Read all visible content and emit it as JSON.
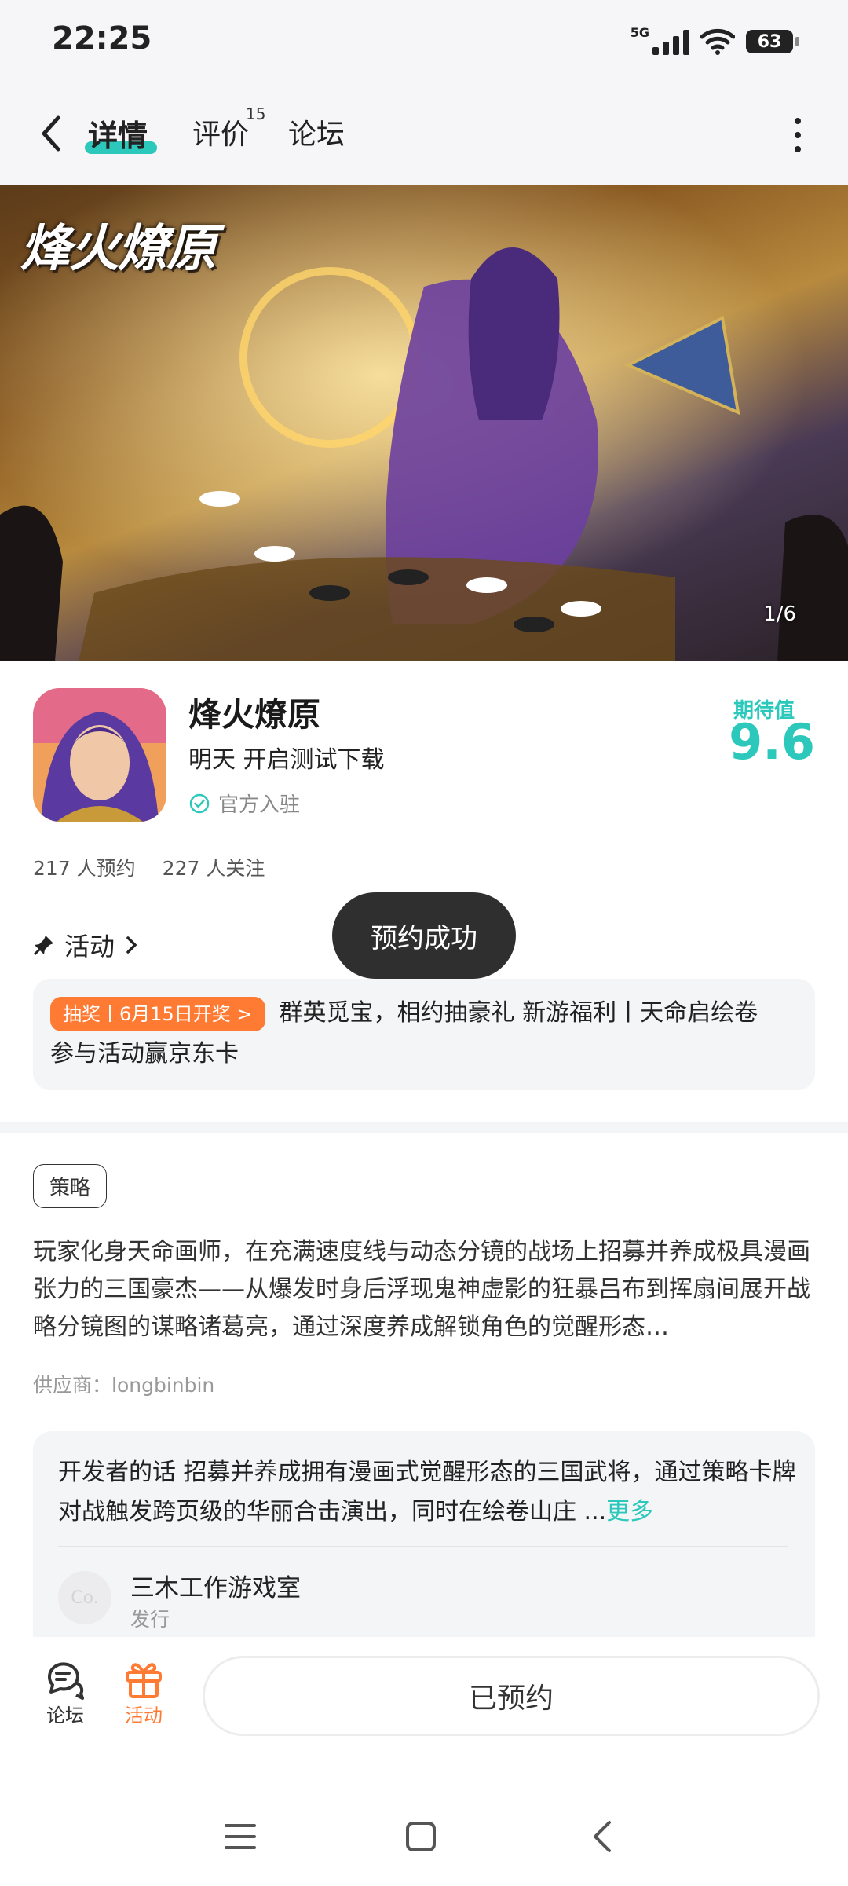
{
  "status_bar": {
    "time": "22:25",
    "network": "5G",
    "battery": "63"
  },
  "top_nav": {
    "tabs": [
      {
        "label": "详情"
      },
      {
        "label": "评价",
        "badge": "15"
      },
      {
        "label": "论坛"
      }
    ]
  },
  "banner": {
    "logo_text": "烽火燎原",
    "counter": "1/6"
  },
  "game": {
    "title": "烽火燎原",
    "subtitle": "明天 开启测试下载",
    "official_label": "官方入驻",
    "rating_label": "期待值",
    "rating_value": "9.6",
    "reservations": "217 人预约",
    "followers": "227 人关注"
  },
  "activity": {
    "header": "活动",
    "tag": "抽奖丨6月15日开奖 >",
    "text": "群英觅宝，相约抽豪礼 新游福利丨天命启绘卷 参与活动赢京东卡"
  },
  "toast": "预约成功",
  "details": {
    "tag": "策略",
    "description": "玩家化身天命画师，在充满速度线与动态分镜的战场上招募并养成极具漫画张力的三国豪杰——从爆发时身后浮现鬼神虚影的狂暴吕布到挥扇间展开战略分镜图的谋略诸葛亮，通过深度养成解锁角色的觉醒形态…",
    "supplier": "供应商：longbinbin"
  },
  "developer": {
    "words": "开发者的话  招募并养成拥有漫画式觉醒形态的三国武将，通过策略卡牌对战触发跨页级的华丽合击演出，同时在绘卷山庄 ...",
    "more": "更多",
    "avatar_text": "Co.",
    "name": "三木工作游戏室",
    "role": "发行"
  },
  "bottom_bar": {
    "forum_label": "论坛",
    "activity_label": "活动",
    "reserve_button": "已预约"
  },
  "colors": {
    "accent": "#2bc8bb",
    "orange": "#ff7a33"
  }
}
